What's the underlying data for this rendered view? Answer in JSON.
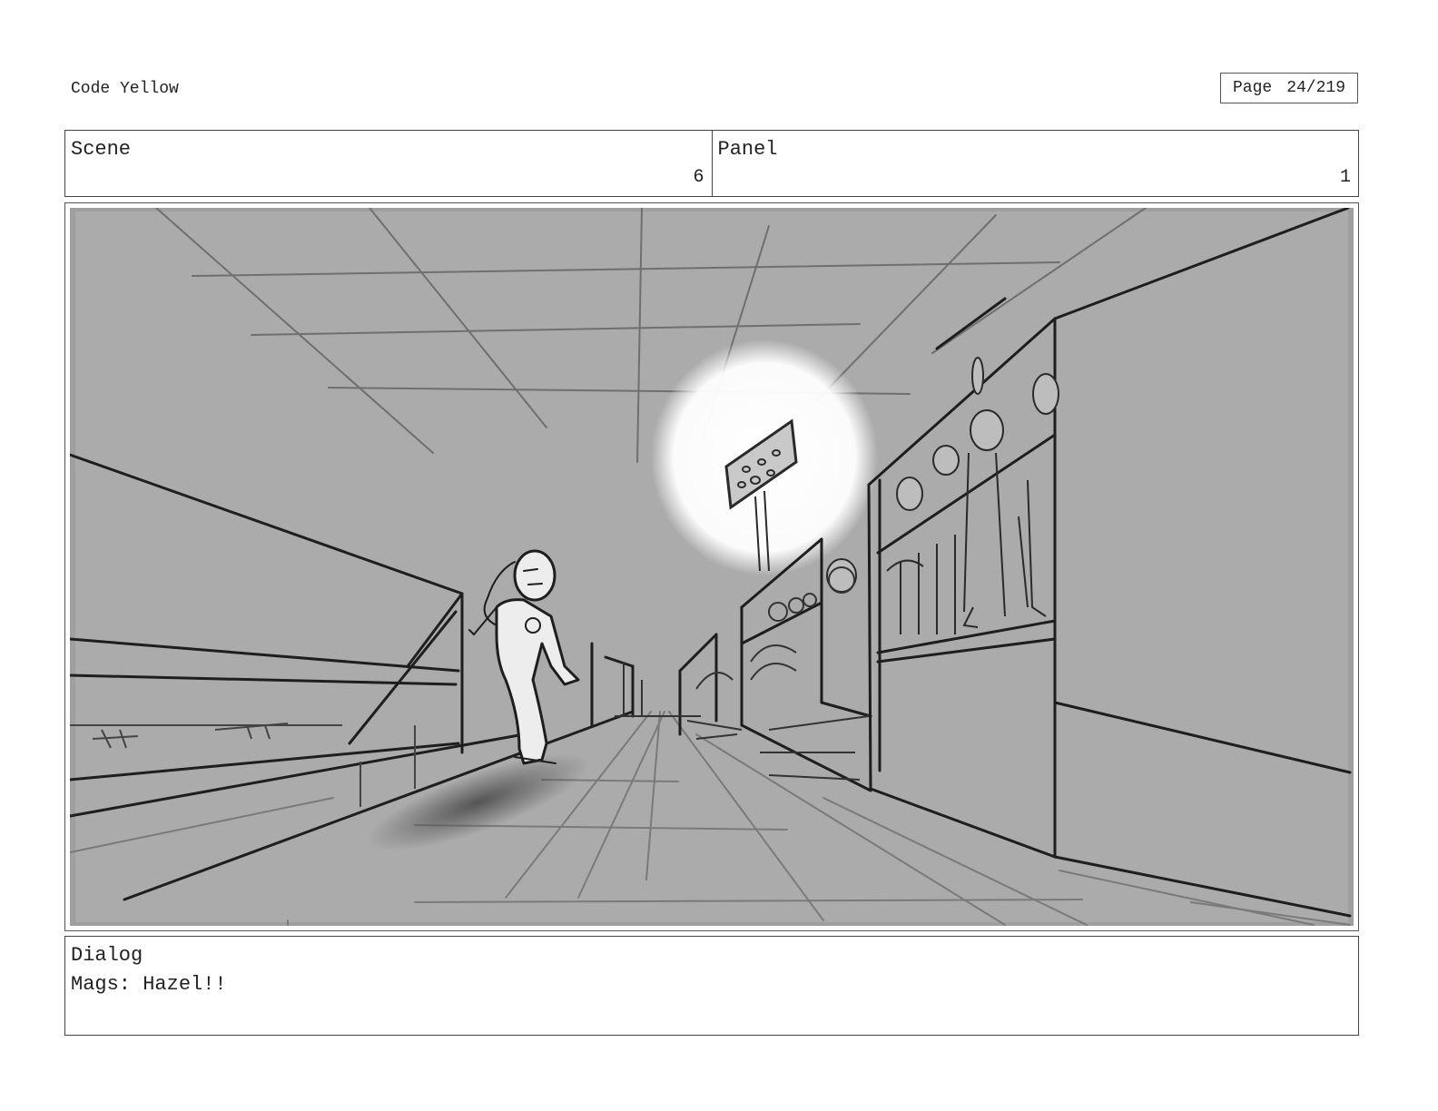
{
  "header": {
    "project_title": "Code Yellow",
    "page_label": "Page",
    "page_number": "24/219"
  },
  "scene": {
    "label": "Scene",
    "value": "6"
  },
  "panel": {
    "label": "Panel",
    "value": "1"
  },
  "dialog": {
    "label": "Dialog",
    "text": "Mags: Hazel!!"
  }
}
